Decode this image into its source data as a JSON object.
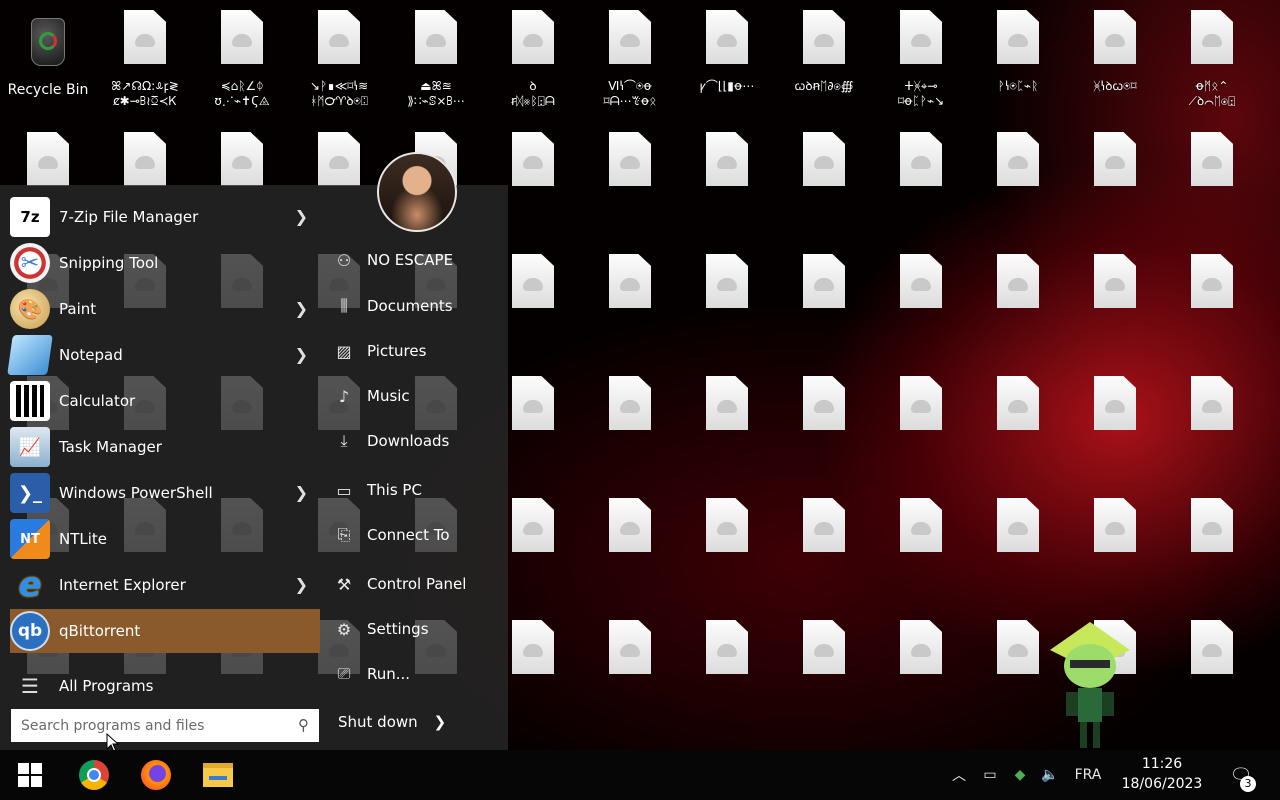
{
  "desktop": {
    "recycle_bin": "Recycle Bin",
    "icons": [
      {
        "l1": "ꕤ↗☊Ω:ꕊꝼ≷",
        "l2": "ȼ✱⊸ꕗ≀ꗞ≺Ꮶ"
      },
      {
        "l1": "≼⌂ᚱ∠ᛰ",
        "l2": "ʊ⋰⌁✝Ϛ⨻"
      },
      {
        "l1": "↘ᚹ∎≪⌑ꝇ≋",
        "l2": "ᚼᛗ℺♈ꝺ⍟⍠"
      },
      {
        "l1": "⏏ꕤ≊",
        "l2": "⟫∷⌁ꕷ⨯ꕗ⋯"
      },
      {
        "l1": "ꝺ",
        "l2": "ꞧᛞ⨳ᛒ⍠ᗩ"
      },
      {
        "l1": "Ⅵꝇ⌒⍟ꝋ",
        "l2": "⌑ᗩ⋯ꔴꝋᛟ"
      },
      {
        "l1": "ꝩ⌒⌊⌊▮ꝋ⋯",
        "l2": ""
      },
      {
        "l1": "ꞷꝺꞥᛖ∂⍟∰",
        "l2": ""
      },
      {
        "l1": "ⵜᚸ⌖⊸",
        "l2": "⌑ꝋᛈᚹ⌁↘"
      },
      {
        "l1": "ᚹꝇ⍟ᛈ⌁ᚱ",
        "l2": ""
      },
      {
        "l1": "ᚸꝇꝺꞷ⍟⌑",
        "l2": ""
      },
      {
        "l1": "ꝋᛗᛟ⌃",
        "l2": "⟋ꝺ⌒ᛖ⍟⍠"
      }
    ]
  },
  "start_menu": {
    "programs": [
      {
        "label": "7-Zip File Manager",
        "icon": "7z"
      },
      {
        "label": "Snipping Tool",
        "icon": "scissors"
      },
      {
        "label": "Paint",
        "icon": "palette"
      },
      {
        "label": "Notepad",
        "icon": "notepad"
      },
      {
        "label": "Calculator",
        "icon": "calculator"
      },
      {
        "label": "Task Manager",
        "icon": "task"
      },
      {
        "label": "Windows PowerShell",
        "icon": "ps"
      },
      {
        "label": "NTLite",
        "icon": "nt"
      },
      {
        "label": "Internet Explorer",
        "icon": "e"
      },
      {
        "label": "qBittorrent",
        "icon": "qb"
      }
    ],
    "all_programs": "All Programs",
    "places": [
      {
        "label": "NO ESCAPE",
        "icon": "user"
      },
      {
        "label": "Documents",
        "icon": "books"
      },
      {
        "label": "Pictures",
        "icon": "picture"
      },
      {
        "label": "Music",
        "icon": "music"
      },
      {
        "label": "Downloads",
        "icon": "download"
      },
      {
        "label": "This PC",
        "icon": "pc"
      },
      {
        "label": "Connect To",
        "icon": "connect"
      },
      {
        "label": "Control Panel",
        "icon": "wrench"
      },
      {
        "label": "Settings",
        "icon": "gear"
      },
      {
        "label": "Run...",
        "icon": "run"
      }
    ],
    "search_placeholder": "Search programs and files",
    "shutdown": "Shut down"
  },
  "taskbar": {
    "language": "FRA",
    "time": "11:26",
    "date": "18/06/2023",
    "notifications": "3"
  },
  "colors": {
    "highlight": "#8a5a2c",
    "taskbar": "#060606"
  }
}
